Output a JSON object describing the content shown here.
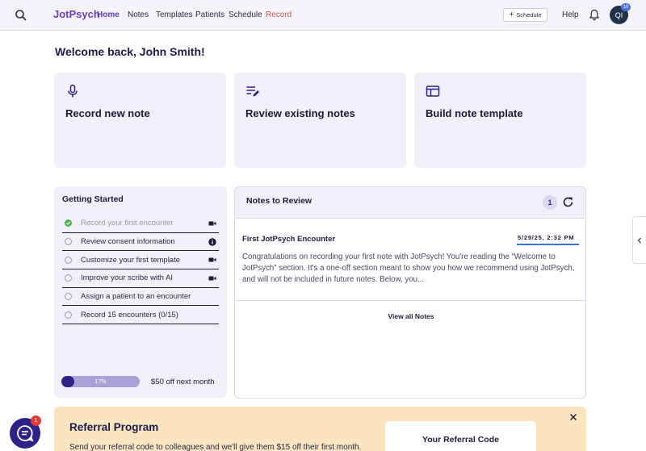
{
  "nav": {
    "logo_badge": "",
    "logo_text": "JotPsych",
    "links": [
      "Home",
      "Notes",
      "Templates",
      "Patients",
      "Schedule",
      "Record"
    ],
    "schedule_button": "Schedule",
    "help": "Help",
    "avatar_initials": "QI",
    "avatar_badge": "10"
  },
  "welcome": "Welcome back, John Smith!",
  "actions": [
    {
      "label": "Record new note",
      "icon": "mic-icon"
    },
    {
      "label": "Review existing notes",
      "icon": "edit-notes-icon"
    },
    {
      "label": "Build note template",
      "icon": "template-icon"
    }
  ],
  "getting_started": {
    "title": "Getting Started",
    "items": [
      {
        "label": "Record your first encounter",
        "done": true,
        "trail_icon": "video-icon"
      },
      {
        "label": "Review consent information",
        "done": false,
        "trail_icon": "info-icon"
      },
      {
        "label": "Customize your first template",
        "done": false,
        "trail_icon": "video-icon"
      },
      {
        "label": "Improve your scribe with AI",
        "done": false,
        "trail_icon": "video-icon"
      },
      {
        "label": "Assign a patient to an encounter",
        "done": false,
        "trail_icon": ""
      },
      {
        "label": "Record 15 encounters (0/15)",
        "done": false,
        "trail_icon": ""
      }
    ],
    "progress_percent": 17,
    "progress_label": "17%",
    "reward": "$50 off next month"
  },
  "notes": {
    "title": "Notes to Review",
    "count": "1",
    "note_title": "First JotPsych Encounter",
    "note_date": "5/29/25, 2:32 PM",
    "note_body": "Congratulations on recording your first note with JotPsych! You're reading the “Welcome to JotPsych” section. It's a one-off section meant to show you how we recommend using JotPsych, and will not be included in future notes. Below, you...",
    "view_all": "View all Notes"
  },
  "referral": {
    "title": "Referral Program",
    "text": "Send your referral code to colleagues and we'll give them $15 off their first month.",
    "card_title": "Your Referral Code"
  },
  "chat_badge": "1",
  "colors": {
    "accent": "#2d2386",
    "panel": "#f1f0f8",
    "referral_bg": "#fbe5c0",
    "record_link": "#d8543b"
  }
}
